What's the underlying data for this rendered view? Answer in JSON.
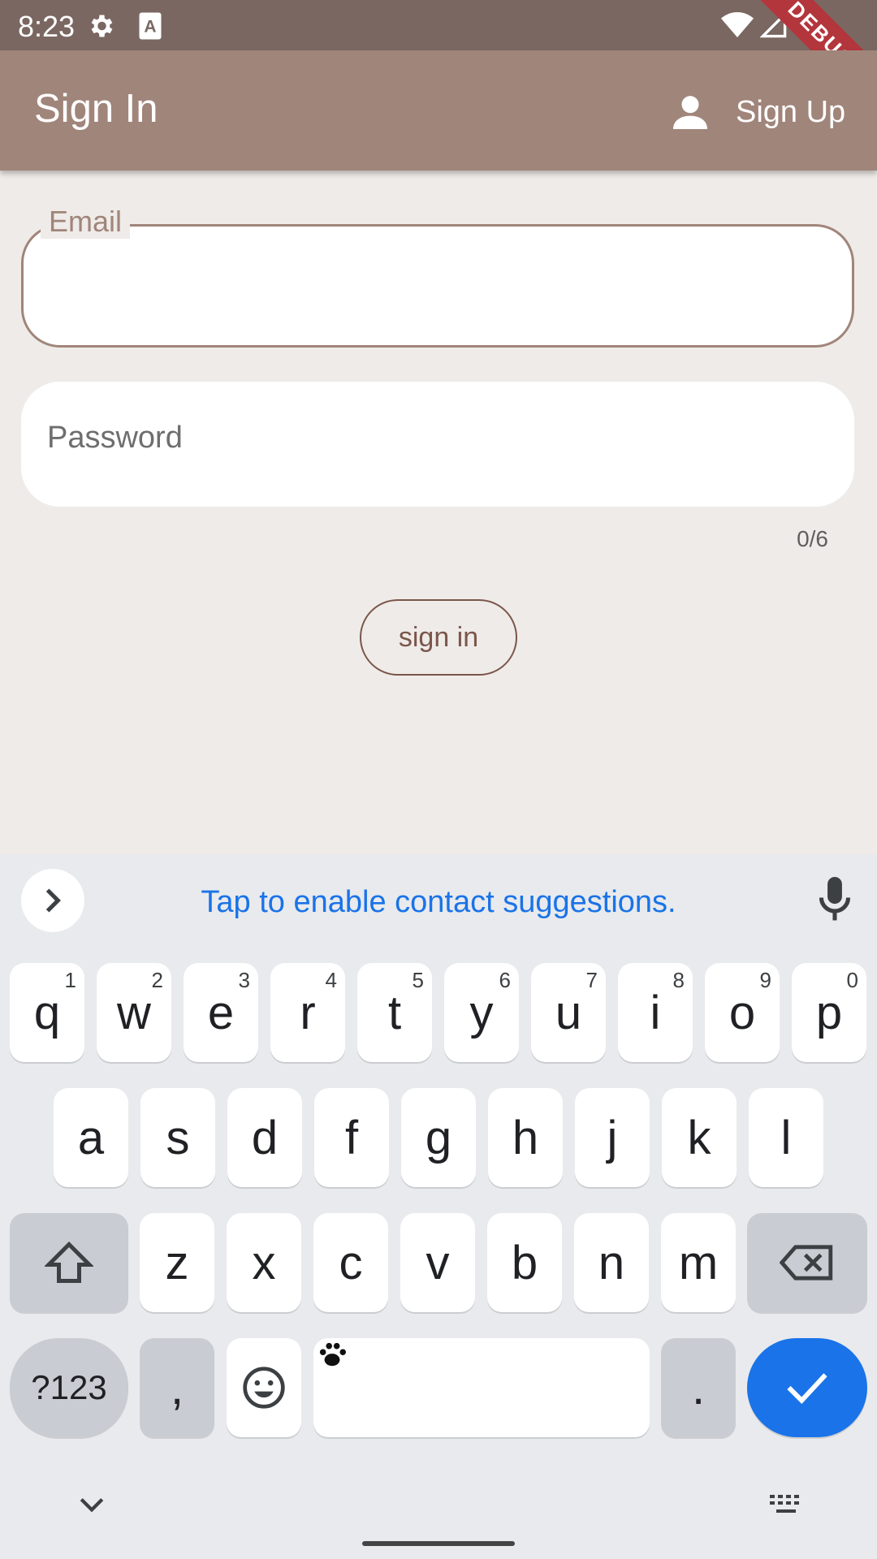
{
  "status_bar": {
    "time": "8:23",
    "icons": [
      "gear-icon",
      "a-badge-icon",
      "wifi-icon",
      "signal-icon",
      "battery-icon"
    ]
  },
  "debug_banner": "DEBUG",
  "app_bar": {
    "title": "Sign In",
    "signup_label": "Sign Up",
    "signup_icon": "person-icon",
    "color": "#a0857a"
  },
  "form": {
    "email_label": "Email",
    "email_value": "",
    "password_label": "Password",
    "password_value": "",
    "password_counter": "0/6",
    "signin_label": "sign in"
  },
  "keyboard": {
    "suggestion": "Tap to enable contact suggestions.",
    "row1": [
      {
        "k": "q",
        "h": "1"
      },
      {
        "k": "w",
        "h": "2"
      },
      {
        "k": "e",
        "h": "3"
      },
      {
        "k": "r",
        "h": "4"
      },
      {
        "k": "t",
        "h": "5"
      },
      {
        "k": "y",
        "h": "6"
      },
      {
        "k": "u",
        "h": "7"
      },
      {
        "k": "i",
        "h": "8"
      },
      {
        "k": "o",
        "h": "9"
      },
      {
        "k": "p",
        "h": "0"
      }
    ],
    "row2": [
      "a",
      "s",
      "d",
      "f",
      "g",
      "h",
      "j",
      "k",
      "l"
    ],
    "row3": [
      "z",
      "x",
      "c",
      "v",
      "b",
      "n",
      "m"
    ],
    "symbols_label": "?123",
    "comma": ",",
    "period": ".",
    "accent_color": "#1a73e8"
  }
}
